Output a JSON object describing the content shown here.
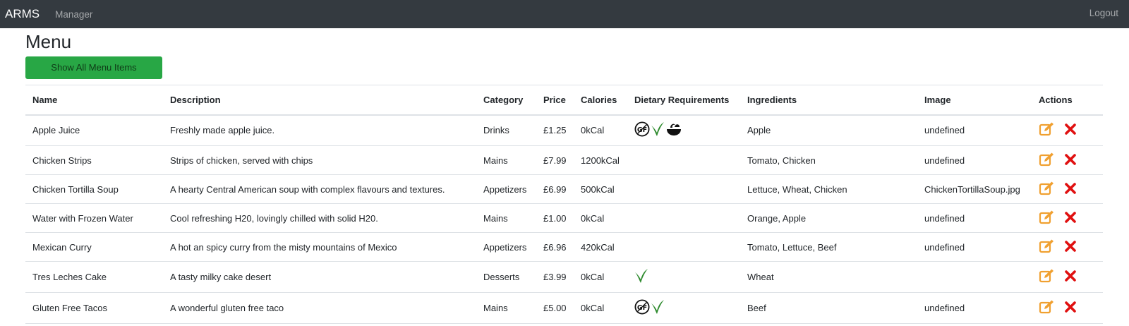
{
  "navbar": {
    "brand": "ARMS",
    "nav_item": "Manager",
    "logout": "Logout"
  },
  "page": {
    "title": "Menu",
    "show_all_button": "Show All Menu Items"
  },
  "colors": {
    "navbar_bg": "#343a40",
    "primary_button": "#28a745",
    "edit_icon": "#f0a030",
    "delete_icon": "#e01010",
    "vegan_icon": "#2e8b2e"
  },
  "table": {
    "headers": [
      "Name",
      "Description",
      "Category",
      "Price",
      "Calories",
      "Dietary Requirements",
      "Ingredients",
      "Image",
      "Actions"
    ],
    "rows": [
      {
        "name": "Apple Juice",
        "description": "Freshly made apple juice.",
        "category": "Drinks",
        "price": "£1.25",
        "calories": "0kCal",
        "dietary": [
          "gluten-free-icon",
          "vegan-leaf-icon",
          "halal-bowl-icon"
        ],
        "ingredients": "Apple",
        "image": "undefined"
      },
      {
        "name": "Chicken Strips",
        "description": "Strips of chicken, served with chips",
        "category": "Mains",
        "price": "£7.99",
        "calories": "1200kCal",
        "dietary": [],
        "ingredients": "Tomato, Chicken",
        "image": "undefined"
      },
      {
        "name": "Chicken Tortilla Soup",
        "description": "A hearty Central American soup with complex flavours and textures.",
        "category": "Appetizers",
        "price": "£6.99",
        "calories": "500kCal",
        "dietary": [],
        "ingredients": "Lettuce, Wheat, Chicken",
        "image": "ChickenTortillaSoup.jpg"
      },
      {
        "name": "Water with Frozen Water",
        "description": "Cool refreshing H20, lovingly chilled with solid H20.",
        "category": "Mains",
        "price": "£1.00",
        "calories": "0kCal",
        "dietary": [],
        "ingredients": "Orange, Apple",
        "image": "undefined"
      },
      {
        "name": "Mexican Curry",
        "description": "A hot an spicy curry from the misty mountains of Mexico",
        "category": "Appetizers",
        "price": "£6.96",
        "calories": "420kCal",
        "dietary": [],
        "ingredients": "Tomato, Lettuce, Beef",
        "image": "undefined"
      },
      {
        "name": "Tres Leches Cake",
        "description": "A tasty milky cake desert",
        "category": "Desserts",
        "price": "£3.99",
        "calories": "0kCal",
        "dietary": [
          "vegan-leaf-icon"
        ],
        "ingredients": "Wheat",
        "image": ""
      },
      {
        "name": "Gluten Free Tacos",
        "description": "A wonderful gluten free taco",
        "category": "Mains",
        "price": "£5.00",
        "calories": "0kCal",
        "dietary": [
          "gluten-free-icon",
          "vegan-leaf-icon"
        ],
        "ingredients": "Beef",
        "image": "undefined"
      }
    ],
    "actions": [
      "edit-icon",
      "delete-icon"
    ]
  }
}
